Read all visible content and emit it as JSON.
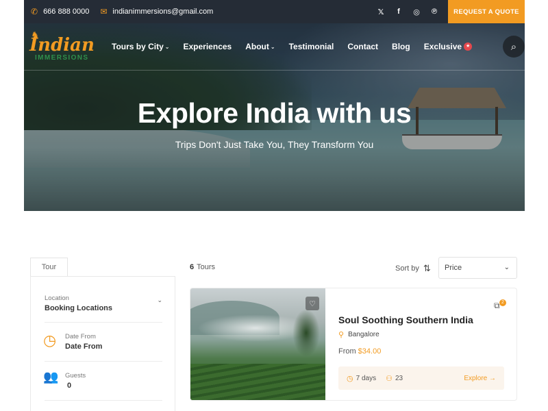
{
  "topbar": {
    "phone": "666 888 0000",
    "email": "indianimmersions@gmail.com",
    "socials": [
      "twitter-icon",
      "facebook-icon",
      "instagram-icon",
      "pinterest-icon"
    ],
    "quote_button": "REQUEST A QUOTE"
  },
  "logo": {
    "top": "Indian",
    "bottom": "IMMERSIONS"
  },
  "nav": {
    "items": [
      {
        "label": "Tours by City",
        "dropdown": true
      },
      {
        "label": "Experiences",
        "dropdown": false
      },
      {
        "label": "About",
        "dropdown": true
      },
      {
        "label": "Testimonial",
        "dropdown": false
      },
      {
        "label": "Contact",
        "dropdown": false
      },
      {
        "label": "Blog",
        "dropdown": false
      },
      {
        "label": "Exclusive",
        "dropdown": false
      }
    ]
  },
  "hero": {
    "title": "Explore India with us",
    "subtitle": "Trips Don't Just Take You, They Transform You"
  },
  "filter": {
    "tab": "Tour",
    "location_label": "Location",
    "location_value": "Booking Locations",
    "date_label": "Date From",
    "date_value": "Date From",
    "guests_label": "Guests",
    "guests_value": "0"
  },
  "results": {
    "count": "6",
    "count_label": "Tours",
    "sort_label": "Sort by",
    "sort_value": "Price"
  },
  "tour": {
    "title": "Soul Soothing Southern India",
    "location": "Bangalore",
    "price_prefix": "From",
    "price": "$34.00",
    "duration": "7 days",
    "group_size": "23",
    "explore": "Explore →",
    "compare_count": "2"
  },
  "colors": {
    "accent": "#f29b22",
    "topbar": "#252c36",
    "logo_green": "#2f8f4c"
  }
}
